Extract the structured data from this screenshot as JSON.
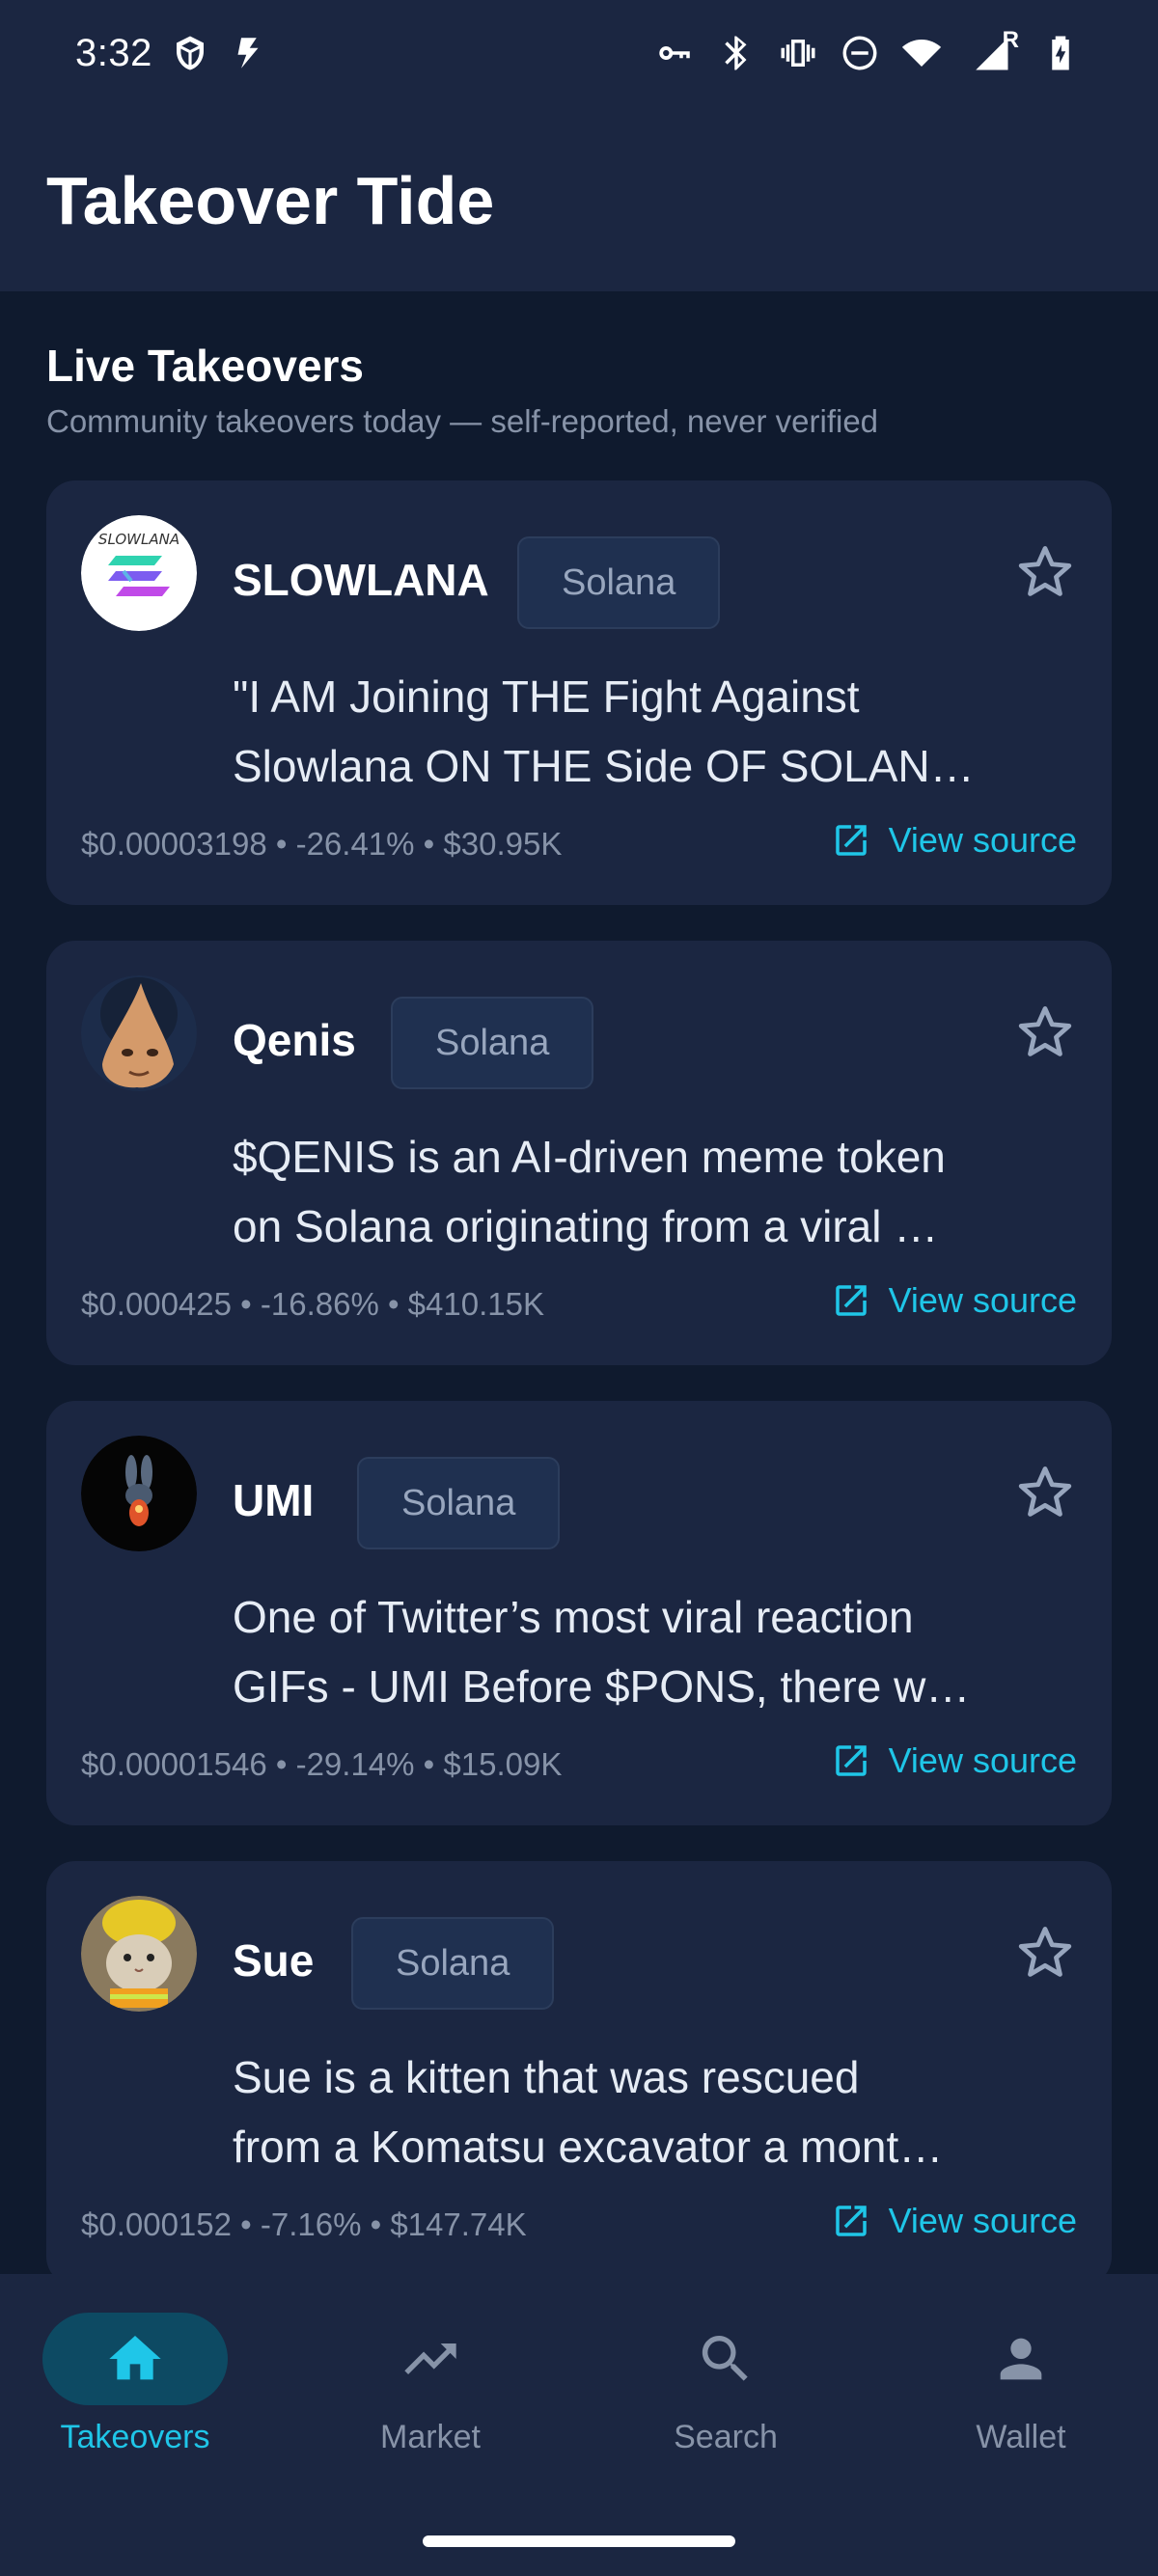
{
  "status_bar": {
    "time": "3:32",
    "left_icons": [
      "shield-app-icon",
      "bolt-app-icon"
    ],
    "right_icons": [
      "vpn-key-icon",
      "bluetooth-icon",
      "vibrate-icon",
      "do-not-disturb-icon",
      "wifi-icon",
      "signal-icon",
      "battery-charging-icon"
    ],
    "roaming_indicator": "R"
  },
  "app": {
    "title": "Takeover Tide"
  },
  "section": {
    "title": "Live Takeovers",
    "subtitle": "Community takeovers today — self-reported, never verified"
  },
  "cards": [
    {
      "name": "SLOWLANA",
      "chain": "Solana",
      "desc_line1": "\"I AM Joining THE Fight Against",
      "desc_line2": "Slowlana ON THE Side OF SOLAN…",
      "stats": "$0.00003198 • -26.41% • $30.95K",
      "link": "View source",
      "avatar_text": "SLOWLANA",
      "favorited": false
    },
    {
      "name": "Qenis",
      "chain": "Solana",
      "desc_line1": "$QENIS is an AI-driven meme token",
      "desc_line2": "on Solana originating from a viral …",
      "stats": "$0.000425 • -16.86% • $410.15K",
      "link": "View source",
      "favorited": false
    },
    {
      "name": "UMI",
      "chain": "Solana",
      "desc_line1": "One of Twitter’s most viral reaction",
      "desc_line2": "GIFs - UMI Before $PONS, there w…",
      "stats": "$0.00001546 • -29.14% • $15.09K",
      "link": "View source",
      "favorited": false
    },
    {
      "name": "Sue",
      "chain": "Solana",
      "desc_line1": "Sue is a kitten that was rescued",
      "desc_line2": "from a Komatsu excavator a mont…",
      "stats": "$0.000152 • -7.16% • $147.74K",
      "link": "View source",
      "favorited": false
    }
  ],
  "bottom_nav": [
    {
      "label": "Takeovers",
      "icon": "home-icon",
      "active": true
    },
    {
      "label": "Market",
      "icon": "trending-up-icon",
      "active": false
    },
    {
      "label": "Search",
      "icon": "search-icon",
      "active": false
    },
    {
      "label": "Wallet",
      "icon": "person-icon",
      "active": false
    }
  ],
  "colors": {
    "background": "#0f1a2e",
    "surface": "#1b2641",
    "accent": "#1fc6e8",
    "active_pill": "#0d4a63",
    "muted_text": "#8793a8"
  }
}
